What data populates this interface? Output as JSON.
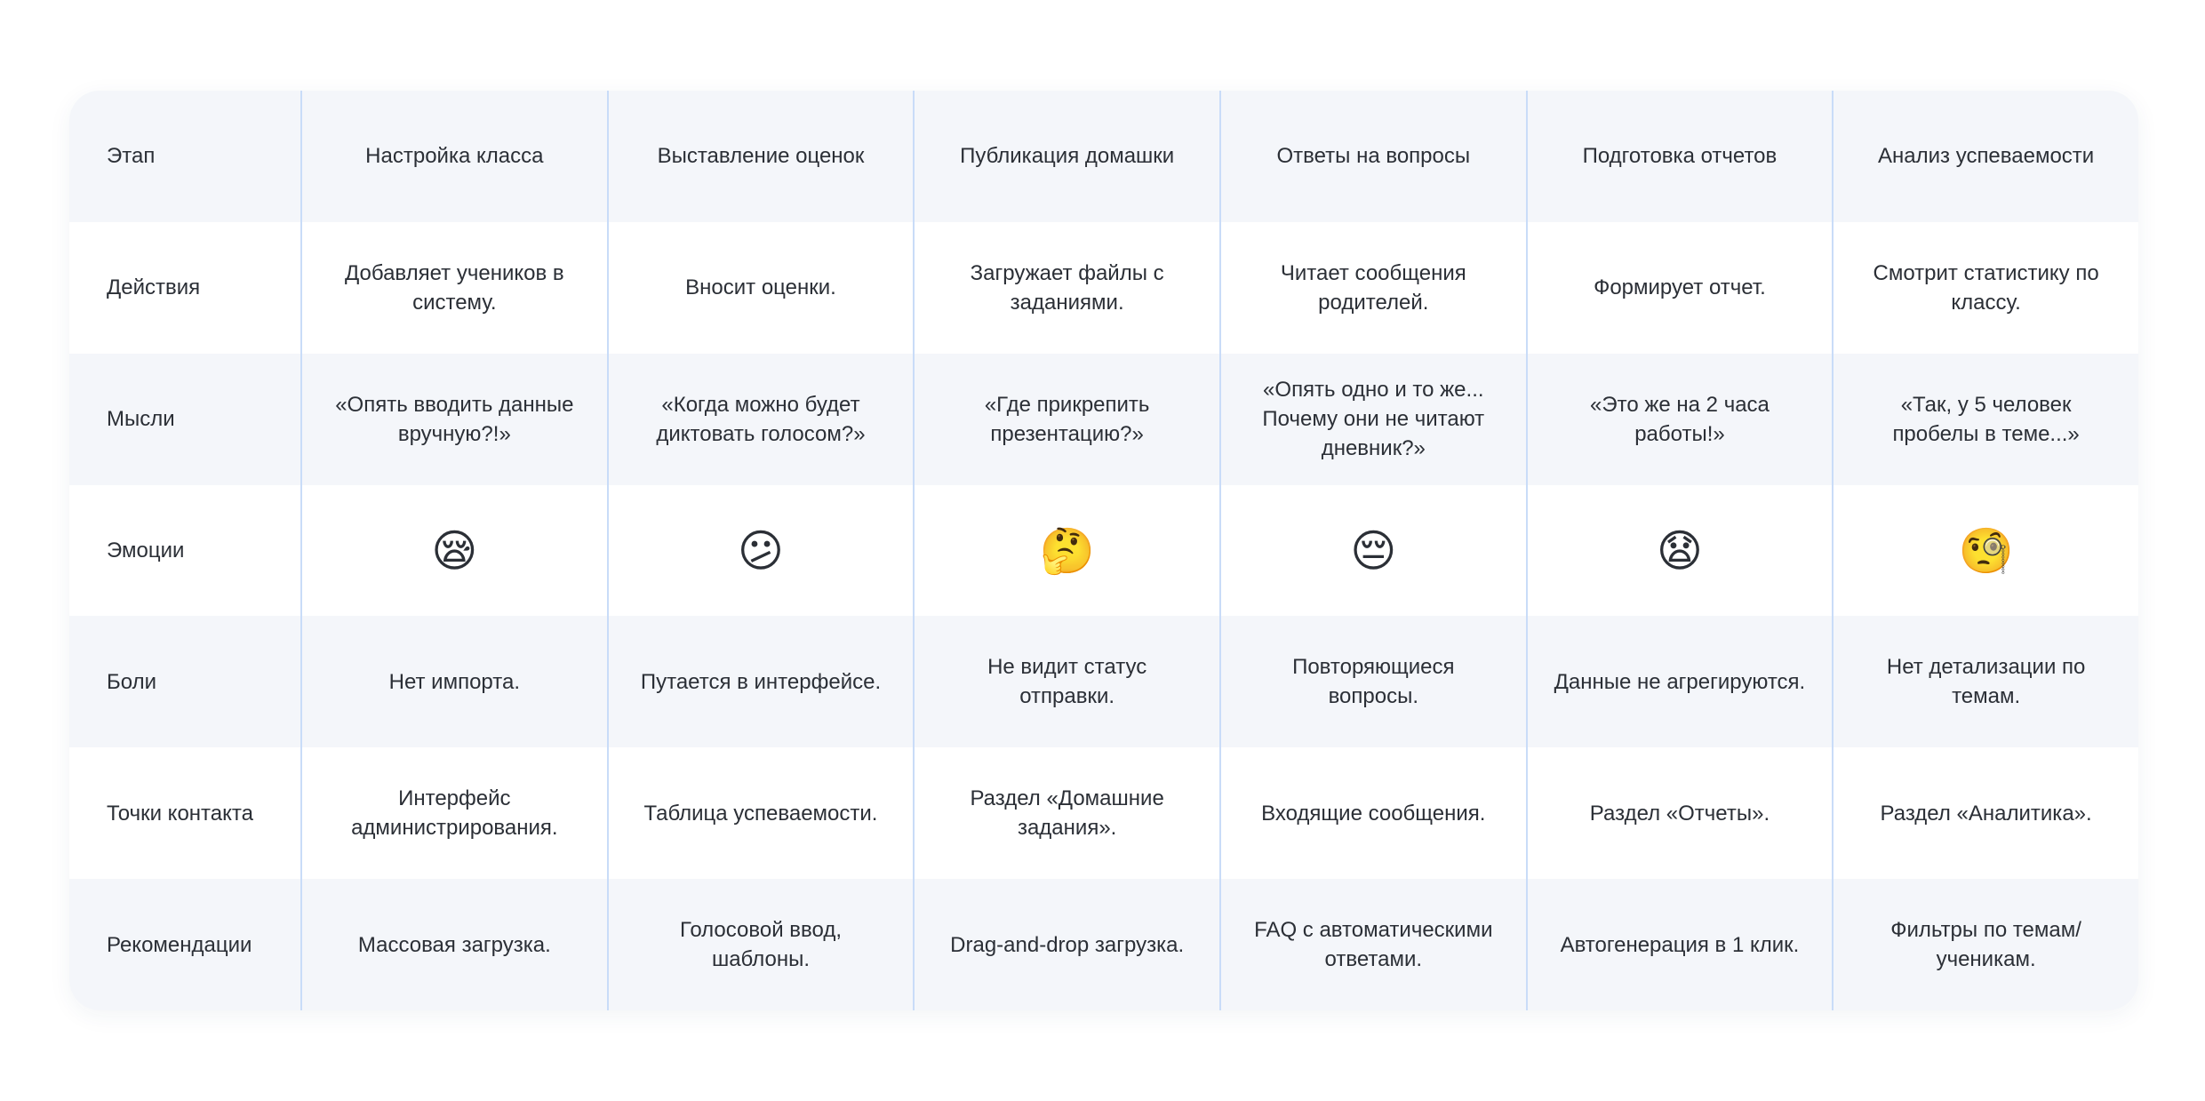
{
  "columns": [
    "Настройка класса",
    "Выставление оценок",
    "Публикация домашки",
    "Ответы на вопросы",
    "Подготовка отчетов",
    "Анализ успеваемости"
  ],
  "rows": [
    {
      "label": "Этап",
      "cells": [
        "Настройка класса",
        "Выставление оценок",
        "Публикация домашки",
        "Ответы на вопросы",
        "Подготовка отчетов",
        "Анализ успеваемости"
      ]
    },
    {
      "label": "Действия",
      "cells": [
        "Добавляет учеников в систему.",
        "Вносит оценки.",
        "Загружает файлы с заданиями.",
        "Читает сообщения родителей.",
        "Формирует отчет.",
        "Смотрит статистику по классу."
      ]
    },
    {
      "label": "Мысли",
      "cells": [
        "«Опять вводить данные вручную?!»",
        "«Когда можно будет диктовать голосом?»",
        "«Где прикрепить презентацию?»",
        "«Опять одно и то же... Почему они не читают дневник?»",
        "«Это же на 2 часа работы!»",
        "«Так, у 5 человек пробелы в теме...»"
      ]
    },
    {
      "label": "Эмоции",
      "cells": [
        "😪",
        "😕",
        "🤔",
        "😔",
        "😧",
        "🧐"
      ],
      "icons": [
        "sleepy-face-icon",
        "confused-face-icon",
        "thinking-face-icon",
        "pensive-face-icon",
        "anguished-face-icon",
        "monocle-face-icon"
      ]
    },
    {
      "label": "Боли",
      "cells": [
        "Нет импорта.",
        "Путается в интерфейсе.",
        "Не видит статус отправки.",
        "Повторяющиеся вопросы.",
        "Данные не агрегируются.",
        "Нет детализации по темам."
      ]
    },
    {
      "label": "Точки контакта",
      "cells": [
        "Интерфейс администрирования.",
        "Таблица успеваемости.",
        "Раздел «Домашние задания».",
        "Входящие сообщения.",
        "Раздел «Отчеты».",
        "Раздел «Аналитика»."
      ]
    },
    {
      "label": "Рекомендации",
      "cells": [
        "Массовая загрузка.",
        "Голосовой ввод, шаблоны.",
        "Drag-and-drop загрузка.",
        "FAQ с автоматическими ответами.",
        "Автогенерация в 1 клик.",
        "Фильтры по темам/ ученикам."
      ]
    }
  ],
  "colors": {
    "row_tint": "#f4f6fa",
    "divider": "#c9dcf8",
    "text": "#2b2f36"
  }
}
